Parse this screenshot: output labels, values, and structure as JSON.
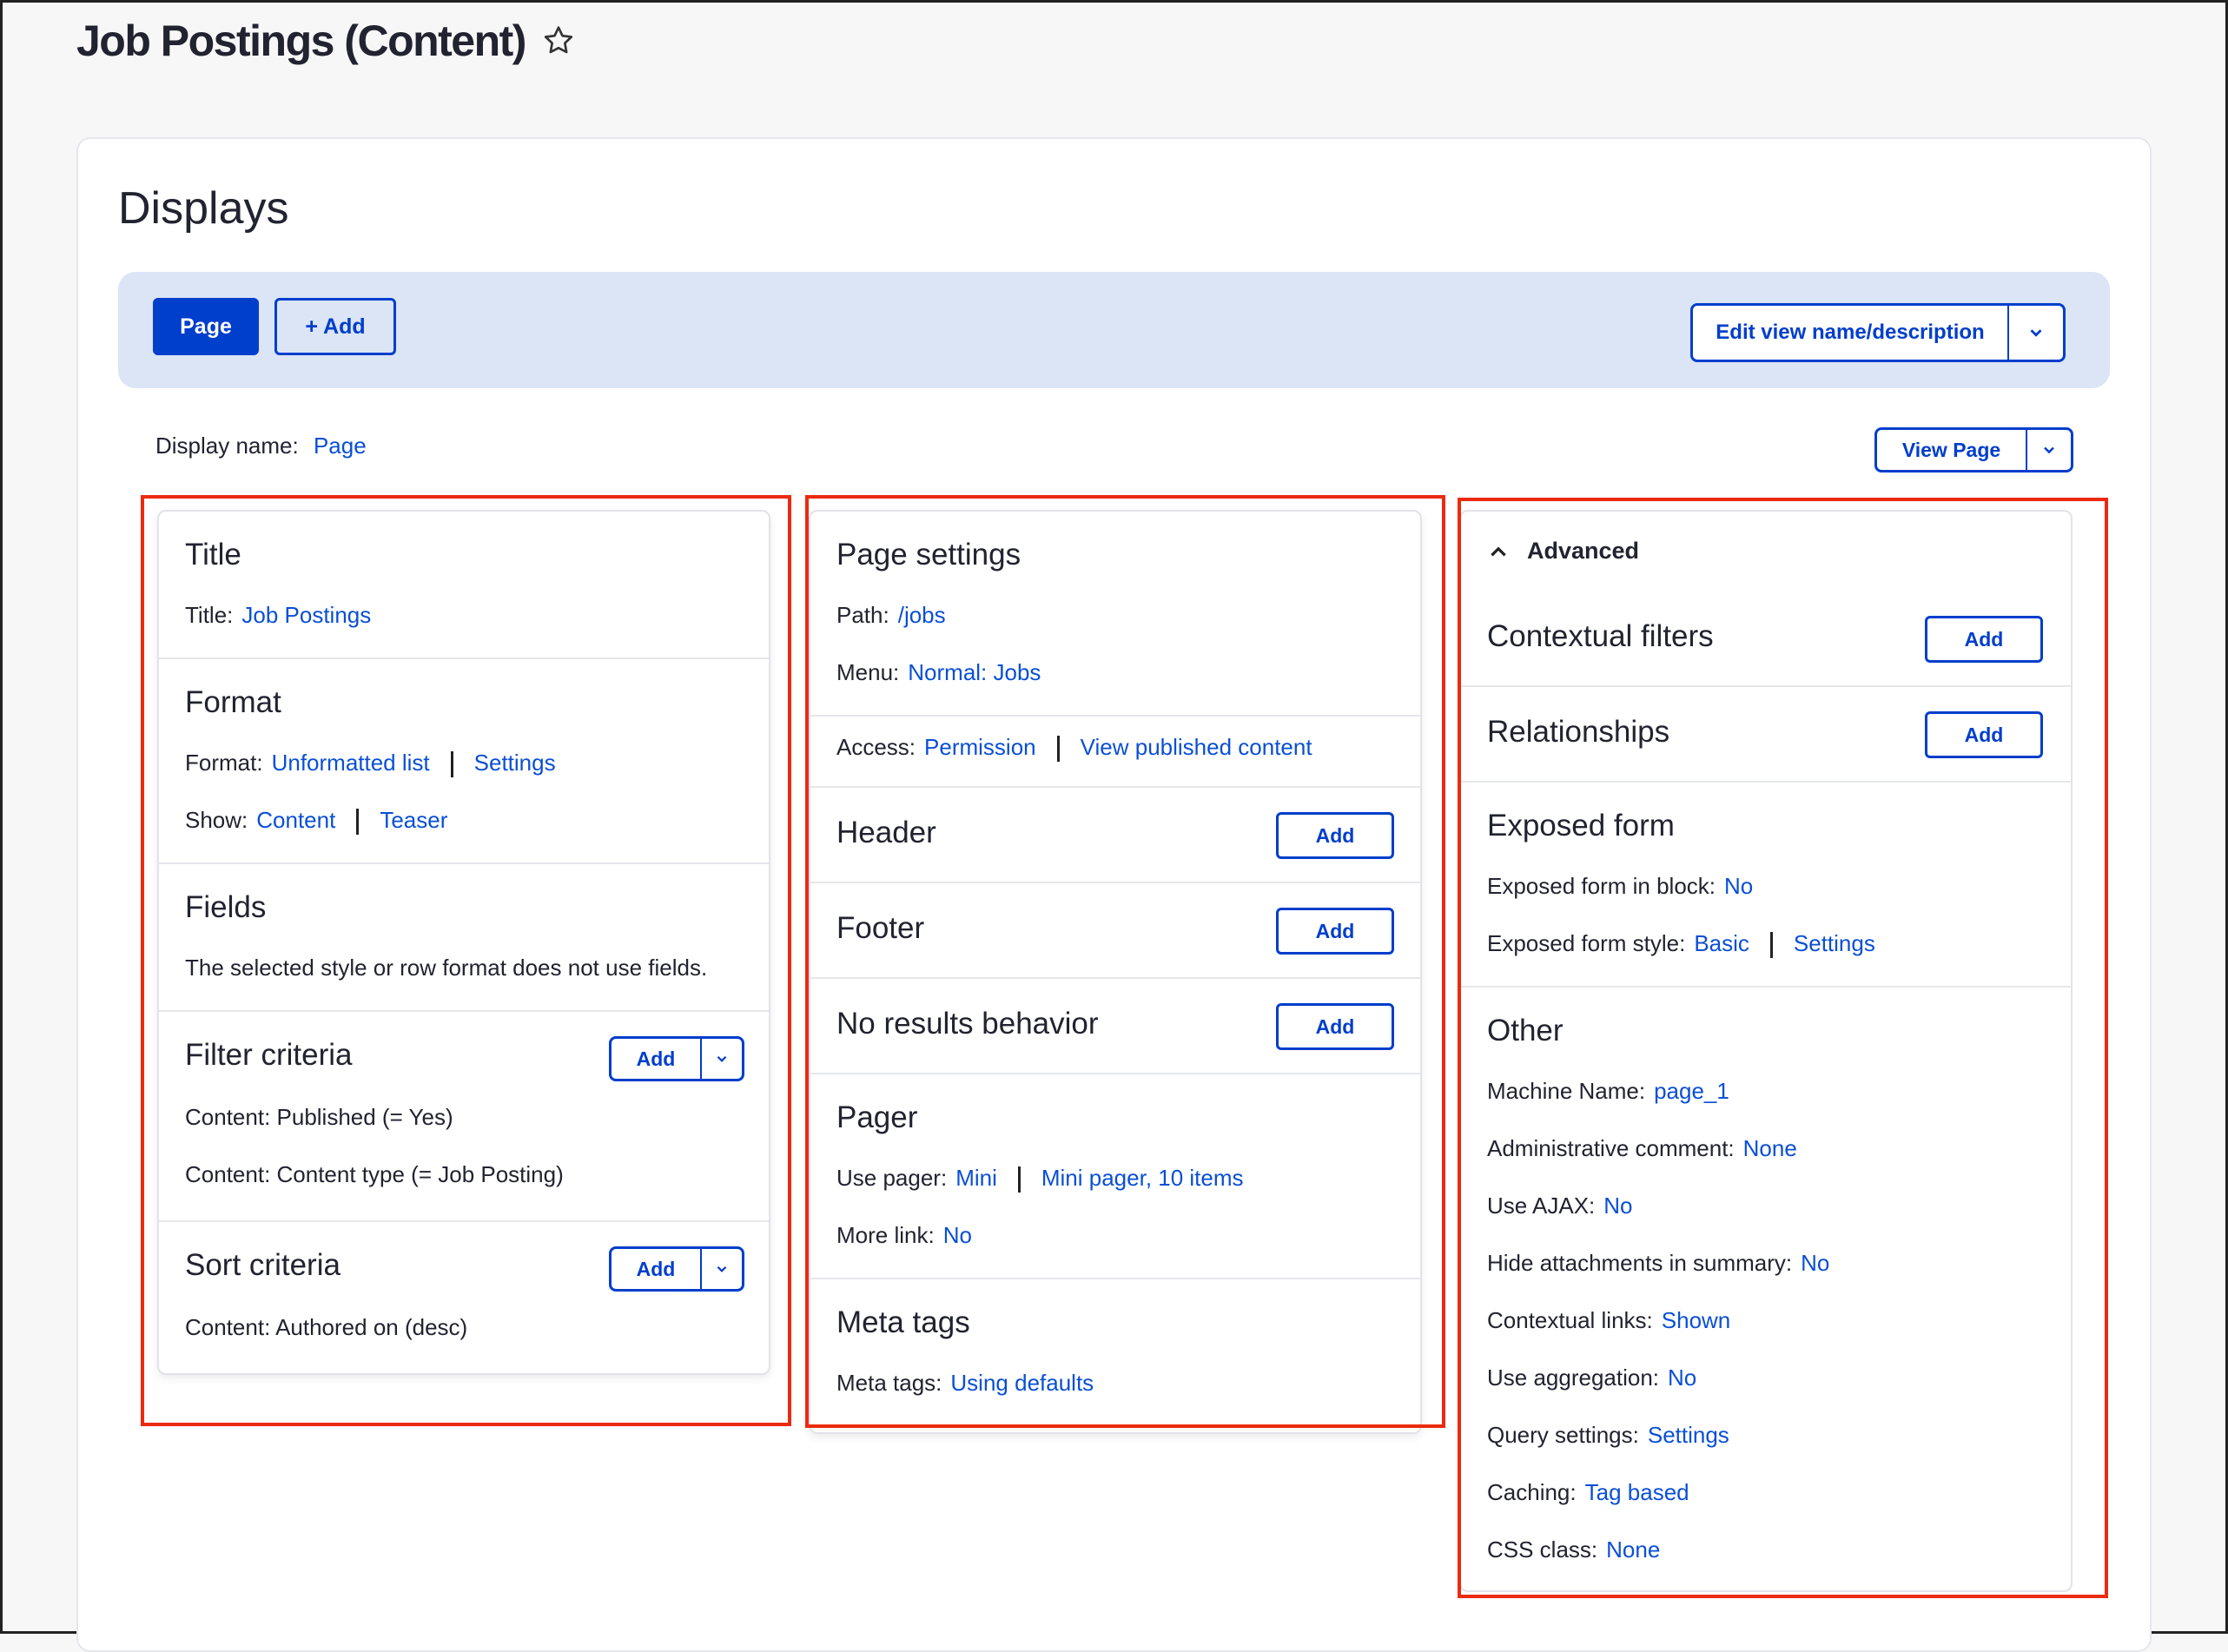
{
  "header": {
    "title": "Job Postings (Content)"
  },
  "displays": {
    "heading": "Displays",
    "tabs": {
      "page": "Page",
      "add": "+ Add"
    },
    "edit_button": "Edit view name/description",
    "display_name_label": "Display name:",
    "display_name_value": "Page",
    "view_page_button": "View Page"
  },
  "left": {
    "title": {
      "heading": "Title",
      "label": "Title:",
      "value": "Job Postings"
    },
    "format": {
      "heading": "Format",
      "format_label": "Format:",
      "format_value": "Unformatted list",
      "format_settings": "Settings",
      "show_label": "Show:",
      "show_value": "Content",
      "show_mode": "Teaser"
    },
    "fields": {
      "heading": "Fields",
      "text": "The selected style or row format does not use fields."
    },
    "filter": {
      "heading": "Filter criteria",
      "add": "Add",
      "items": [
        "Content: Published (= Yes)",
        "Content: Content type (= Job Posting)"
      ]
    },
    "sort": {
      "heading": "Sort criteria",
      "add": "Add",
      "items": [
        "Content: Authored on (desc)"
      ]
    }
  },
  "middle": {
    "page_settings": {
      "heading": "Page settings",
      "path_label": "Path:",
      "path_value": "/jobs",
      "menu_label": "Menu:",
      "menu_value": "Normal: Jobs",
      "access_label": "Access:",
      "access_value": "Permission",
      "access_detail": "View published content"
    },
    "header": {
      "heading": "Header",
      "add": "Add"
    },
    "footer": {
      "heading": "Footer",
      "add": "Add"
    },
    "no_results": {
      "heading": "No results behavior",
      "add": "Add"
    },
    "pager": {
      "heading": "Pager",
      "use_label": "Use pager:",
      "use_value": "Mini",
      "use_detail": "Mini pager, 10 items",
      "more_label": "More link:",
      "more_value": "No"
    },
    "meta": {
      "heading": "Meta tags",
      "label": "Meta tags:",
      "value": "Using defaults"
    }
  },
  "right": {
    "advanced": "Advanced",
    "contextual": {
      "heading": "Contextual filters",
      "add": "Add"
    },
    "relationships": {
      "heading": "Relationships",
      "add": "Add"
    },
    "exposed": {
      "heading": "Exposed form",
      "block_label": "Exposed form in block:",
      "block_value": "No",
      "style_label": "Exposed form style:",
      "style_value": "Basic",
      "style_settings": "Settings"
    },
    "other": {
      "heading": "Other",
      "rows": [
        {
          "label": "Machine Name:",
          "value": "page_1"
        },
        {
          "label": "Administrative comment:",
          "value": "None"
        },
        {
          "label": "Use AJAX:",
          "value": "No"
        },
        {
          "label": "Hide attachments in summary:",
          "value": "No"
        },
        {
          "label": "Contextual links:",
          "value": "Shown"
        },
        {
          "label": "Use aggregation:",
          "value": "No"
        },
        {
          "label": "Query settings:",
          "value": "Settings"
        },
        {
          "label": "Caching:",
          "value": "Tag based"
        },
        {
          "label": "CSS class:",
          "value": "None"
        }
      ]
    }
  },
  "colors": {
    "accent": "#003ecc",
    "link": "#0a4fd6",
    "highlight": "#ec2a0f",
    "tabs_bg": "#dbe5f6"
  }
}
